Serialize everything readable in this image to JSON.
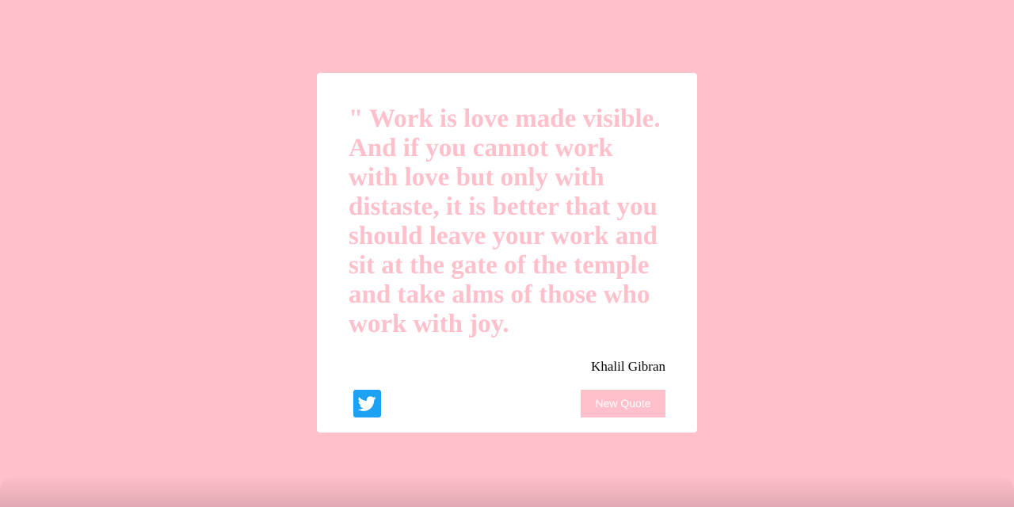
{
  "quote": {
    "text": "\" Work is love made visible. And if you cannot work with love but only with distaste, it is better that you should leave your work and sit at the gate of the temple and take alms of those who work with joy.",
    "author": "Khalil Gibran"
  },
  "actions": {
    "tweet_icon": "twitter-icon",
    "new_quote_label": "New Quote"
  },
  "colors": {
    "background": "#ffc0cb",
    "card": "#ffffff",
    "quote_text": "#ffc0cb",
    "author_text": "#000000",
    "twitter_blue": "#1da1f2",
    "button_bg": "#ffc0cb",
    "button_text": "#ffffff"
  }
}
